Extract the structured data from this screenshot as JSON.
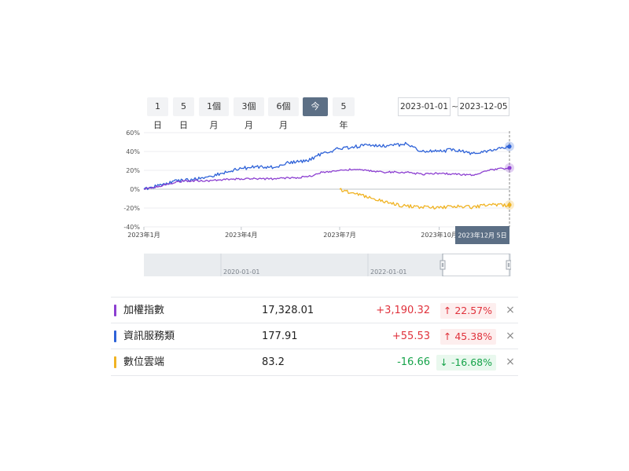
{
  "range_buttons": [
    {
      "label": "1日",
      "active": false
    },
    {
      "label": "5日",
      "active": false
    },
    {
      "label": "1個月",
      "active": false
    },
    {
      "label": "3個月",
      "active": false
    },
    {
      "label": "6個月",
      "active": false
    },
    {
      "label": "今年",
      "active": true
    },
    {
      "label": "5年",
      "active": false
    }
  ],
  "date_range": {
    "start": "2023-01-01",
    "separator": "~",
    "end": "2023-12-05"
  },
  "navigator": {
    "labels": [
      "2020-01-01",
      "2022-01-01"
    ]
  },
  "chart_data": {
    "type": "line",
    "yticks": [
      "60%",
      "40%",
      "20%",
      "0%",
      "-20%",
      "-40%"
    ],
    "ylim": [
      -40,
      60
    ],
    "xlim": [
      "2023-01-01",
      "2023-12-05"
    ],
    "xticks": [
      "2023年1月",
      "2023年4月",
      "2023年7月",
      "2023年10月"
    ],
    "crosshair_label": "2023年12月 5日",
    "grid": true,
    "series": [
      {
        "name": "資訊服務類",
        "color": "#2e62d8",
        "points": [
          [
            "2023-01-01",
            0
          ],
          [
            "2023-01-15",
            4
          ],
          [
            "2023-02-01",
            9
          ],
          [
            "2023-02-15",
            10
          ],
          [
            "2023-03-01",
            13
          ],
          [
            "2023-03-15",
            17
          ],
          [
            "2023-04-01",
            22
          ],
          [
            "2023-04-15",
            24
          ],
          [
            "2023-05-01",
            23
          ],
          [
            "2023-05-15",
            28
          ],
          [
            "2023-06-01",
            30
          ],
          [
            "2023-06-15",
            38
          ],
          [
            "2023-07-01",
            43
          ],
          [
            "2023-07-15",
            45
          ],
          [
            "2023-08-01",
            47
          ],
          [
            "2023-08-15",
            46
          ],
          [
            "2023-09-01",
            48
          ],
          [
            "2023-09-15",
            40
          ],
          [
            "2023-10-01",
            40
          ],
          [
            "2023-10-15",
            42
          ],
          [
            "2023-11-01",
            38
          ],
          [
            "2023-11-15",
            41
          ],
          [
            "2023-12-05",
            45.38
          ]
        ]
      },
      {
        "name": "加權指數",
        "color": "#8c3fd1",
        "points": [
          [
            "2023-01-01",
            0
          ],
          [
            "2023-01-15",
            3
          ],
          [
            "2023-02-01",
            8
          ],
          [
            "2023-02-15",
            9
          ],
          [
            "2023-03-01",
            9
          ],
          [
            "2023-03-15",
            10
          ],
          [
            "2023-04-01",
            11
          ],
          [
            "2023-04-15",
            11
          ],
          [
            "2023-05-01",
            11
          ],
          [
            "2023-05-15",
            12
          ],
          [
            "2023-06-01",
            13
          ],
          [
            "2023-06-15",
            18
          ],
          [
            "2023-07-01",
            20
          ],
          [
            "2023-07-15",
            21
          ],
          [
            "2023-08-01",
            19
          ],
          [
            "2023-08-15",
            18
          ],
          [
            "2023-09-01",
            18
          ],
          [
            "2023-09-15",
            16
          ],
          [
            "2023-10-01",
            17
          ],
          [
            "2023-10-15",
            16
          ],
          [
            "2023-11-01",
            15
          ],
          [
            "2023-11-15",
            20
          ],
          [
            "2023-12-05",
            22.57
          ]
        ]
      },
      {
        "name": "數位雲端",
        "color": "#f0b323",
        "points": [
          [
            "2023-07-01",
            0
          ],
          [
            "2023-07-15",
            -5
          ],
          [
            "2023-08-01",
            -10
          ],
          [
            "2023-08-15",
            -15
          ],
          [
            "2023-09-01",
            -18
          ],
          [
            "2023-09-15",
            -19
          ],
          [
            "2023-10-01",
            -20
          ],
          [
            "2023-10-15",
            -18
          ],
          [
            "2023-11-01",
            -19
          ],
          [
            "2023-11-15",
            -17
          ],
          [
            "2023-12-05",
            -16.68
          ]
        ]
      }
    ]
  },
  "legend": [
    {
      "name": "加權指數",
      "color": "#8c3fd1",
      "value": "17,328.01",
      "change": "+3,190.32",
      "percent": "22.57%",
      "direction": "up",
      "arrow": "↑"
    },
    {
      "name": "資訊服務類",
      "color": "#2e62d8",
      "value": "177.91",
      "change": "+55.53",
      "percent": "45.38%",
      "direction": "up",
      "arrow": "↑"
    },
    {
      "name": "數位雲端",
      "color": "#f0b323",
      "value": "83.2",
      "change": "-16.66",
      "percent": "-16.68%",
      "direction": "down",
      "arrow": "↓"
    }
  ],
  "remove_icon": "×"
}
